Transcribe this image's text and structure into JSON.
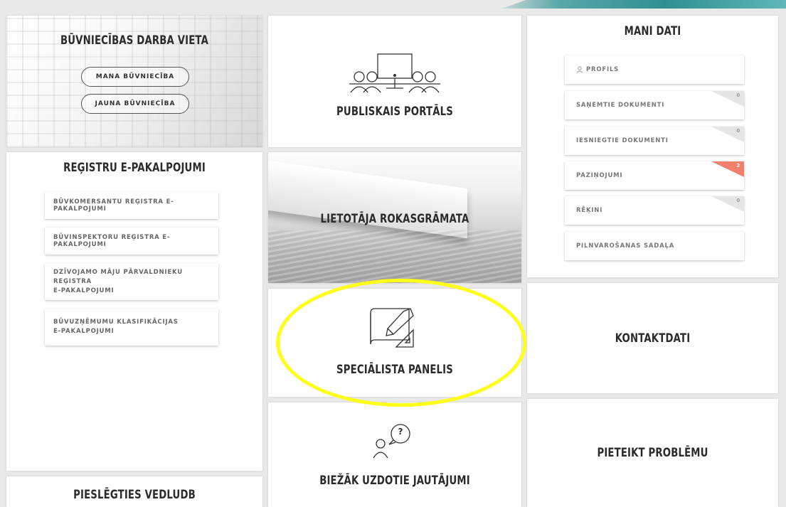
{
  "tiles": {
    "build": {
      "title": "BŪVNIECĪBAS DARBA VIETA",
      "buttons": [
        "MANA BŪVNIECĪBA",
        "JAUNA BŪVNIECĪBA"
      ]
    },
    "portal": {
      "title": "PUBLISKAIS PORTĀLS",
      "icon": "meeting-screen-icon"
    },
    "mydata": {
      "title": "MANI DATI",
      "items": [
        {
          "label": "PROFILS",
          "icon": "user-icon"
        },
        {
          "label": "SAŅEMTIE DOKUMENTI",
          "count": "0"
        },
        {
          "label": "IESNIEGTIE DOKUMENTI",
          "count": "0"
        },
        {
          "label": "PAZIŅOJUMI",
          "count": "2"
        },
        {
          "label": "RĒĶINI",
          "count": "0"
        },
        {
          "label": "PILNVAROŠANAS SADAĻA"
        }
      ]
    },
    "registry": {
      "title": "REĢISTRU E-PAKALPOJUMI",
      "items": [
        "BŪVKOMERSANTU REĢISTRA E-PAKALPOJUMI",
        "BŪVINSPEKTORU REĢISTRA E-PAKALPOJUMI",
        "DZĪVOJAMO MĀJU PĀRVALDNIEKU REĢISTRA\nE-PAKALPOJUMI",
        "BŪVUZŅĒMUMU KLASIFIKĀCIJAS\nE-PAKALPOJUMI"
      ]
    },
    "manual": {
      "title": "LIETOTĀJA ROKASGRĀMATA"
    },
    "specialist": {
      "title": "SPECIĀLISTA PANELIS",
      "icon": "blueprint-pencil-icon"
    },
    "contacts": {
      "title": "KONTAKTDATI"
    },
    "faq": {
      "title": "BIEŽĀK UZDOTIE JAUTĀJUMI",
      "icon": "question-bubble-icon",
      "icon_text": "?"
    },
    "report": {
      "title": "PIETEIKT PROBLĒMU"
    },
    "vedludb": {
      "title": "PIESLĒGTIES VEDLUDB"
    }
  },
  "colors": {
    "highlight": "#ffff1a",
    "badge_alert": "#f07f6b",
    "accent": "#2f8f92"
  }
}
